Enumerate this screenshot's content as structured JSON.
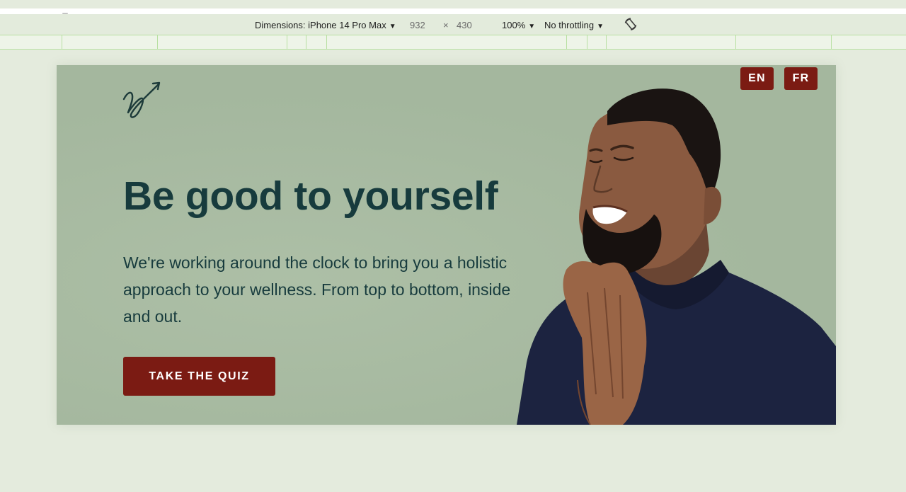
{
  "devtools": {
    "dimensions_label": "Dimensions: iPhone 14 Pro Max",
    "width": "932",
    "times": "×",
    "height": "430",
    "zoom": "100%",
    "throttling": "No throttling",
    "icons": [
      "chevron-down-icon",
      "rotate-icon"
    ]
  },
  "hero": {
    "title": "Be good to yourself",
    "body": "We're working around the clock to bring you a holistic approach to your wellness. From top to bottom, inside and out.",
    "cta_label": "TAKE THE QUIZ",
    "languages": {
      "en": "EN",
      "fr": "FR"
    },
    "logo_icon": "signature-arrow-logo"
  },
  "colors": {
    "page_bg": "#e4ebdd",
    "hero_bg": "#a4b79e",
    "heading": "#173b3d",
    "accent": "#7b1b13",
    "ruler_line": "#b8e0a2",
    "sweater": "#1c2340"
  }
}
